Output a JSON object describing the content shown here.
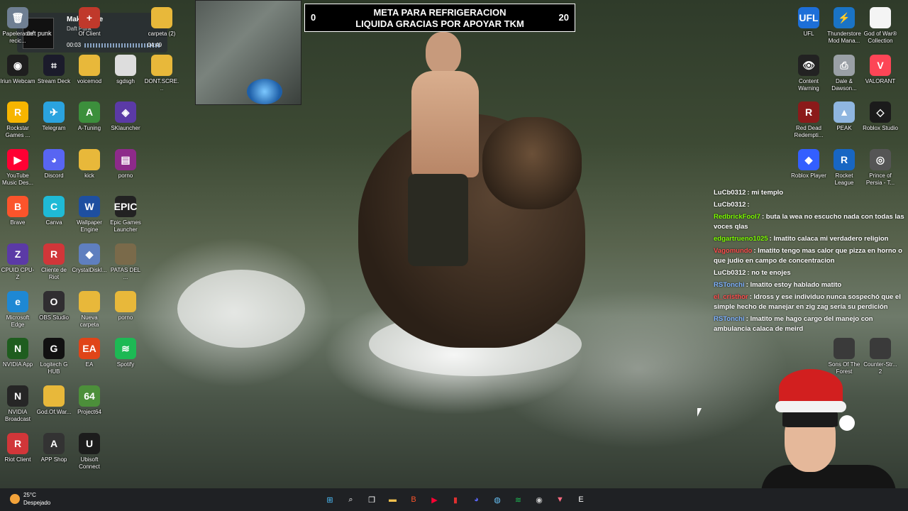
{
  "goal_widget": {
    "left": "0",
    "text_line1": "META PARA REFRIGERACION",
    "text_line2": "LIQUIDA GRACIAS POR APOYAR TKM",
    "right": "20"
  },
  "music_widget": {
    "album": "daft punk",
    "title": "Make Love",
    "artist": "Daft Punk",
    "elapsed": "00:03",
    "total": "04:49"
  },
  "desktop_icons": [
    {
      "label": "Papelera de recic...",
      "icon": "recycle-bin-icon",
      "color": "#6f7f93",
      "glyph": "🗑"
    },
    {
      "label": "Iriun Webcam",
      "icon": "webcam-icon",
      "color": "#1e1e1e",
      "glyph": "◉"
    },
    {
      "label": "Rockstar Games ...",
      "icon": "rockstar-icon",
      "color": "#f7b500",
      "glyph": "R"
    },
    {
      "label": "YouTube Music Des...",
      "icon": "youtube-music-icon",
      "color": "#ff0033",
      "glyph": "▶"
    },
    {
      "label": "Brave",
      "icon": "brave-icon",
      "color": "#fb542b",
      "glyph": "B"
    },
    {
      "label": "CPUID CPU-Z",
      "icon": "cpuz-icon",
      "color": "#5b3aa6",
      "glyph": "Z"
    },
    {
      "label": "Microsoft Edge",
      "icon": "edge-icon",
      "color": "#1e88d4",
      "glyph": "e"
    },
    {
      "label": "NVIDIA App",
      "icon": "nvidia-icon",
      "color": "#1f5d1f",
      "glyph": "N"
    },
    {
      "label": "NVIDIA Broadcast",
      "icon": "nvidia-broadcast-icon",
      "color": "#262626",
      "glyph": "N"
    },
    {
      "label": "Riot Client",
      "icon": "riot-icon",
      "color": "#d13639",
      "glyph": "R"
    },
    {
      "label": "OBS Studio",
      "icon": "obs-icon",
      "color": "#302e31",
      "glyph": "O"
    },
    {
      "label": "Stream Deck",
      "icon": "stream-deck-icon",
      "color": "#1b1b2b",
      "glyph": "⌗"
    },
    {
      "label": "Telegram",
      "icon": "telegram-icon",
      "color": "#2aa3df",
      "glyph": "✈"
    },
    {
      "label": "Discord",
      "icon": "discord-icon",
      "color": "#5865f2",
      "glyph": "◕"
    },
    {
      "label": "Canva",
      "icon": "canva-icon",
      "color": "#1fbad6",
      "glyph": "C"
    },
    {
      "label": "Cliente de Riot",
      "icon": "riot-client-icon",
      "color": "#d13639",
      "glyph": "R"
    },
    {
      "label": "OBS Studio",
      "icon": "obs-icon-2",
      "color": "#302e31",
      "glyph": "O"
    },
    {
      "label": "Logitech G HUB",
      "icon": "logitech-icon",
      "color": "#111111",
      "glyph": "G"
    },
    {
      "label": "God.Of.War...",
      "icon": "folder-icon",
      "color": "#e8b83a",
      "glyph": ""
    },
    {
      "label": "APP Shop",
      "icon": "app-shop-icon",
      "color": "#333333",
      "glyph": "A"
    },
    {
      "label": "Of Client",
      "icon": "client-icon",
      "color": "#c0392b",
      "glyph": "+"
    },
    {
      "label": "voicemod",
      "icon": "folder-icon-2",
      "color": "#e8b83a",
      "glyph": ""
    },
    {
      "label": "A-Tuning",
      "icon": "a-tuning-icon",
      "color": "#3c8f3c",
      "glyph": "A"
    },
    {
      "label": "kick",
      "icon": "kick-folder-icon",
      "color": "#e8b83a",
      "glyph": ""
    },
    {
      "label": "Wallpaper Engine",
      "icon": "wallpaper-engine-icon",
      "color": "#1e4fa0",
      "glyph": "W"
    },
    {
      "label": "CrystalDiskI...",
      "icon": "crystaldisk-icon",
      "color": "#5f7fbf",
      "glyph": "◆"
    },
    {
      "label": "Nueva carpeta",
      "icon": "new-folder-icon",
      "color": "#e8b83a",
      "glyph": ""
    },
    {
      "label": "EA",
      "icon": "ea-icon",
      "color": "#e04418",
      "glyph": "EA"
    },
    {
      "label": "Project64",
      "icon": "project64-icon",
      "color": "#4c8f3a",
      "glyph": "64"
    },
    {
      "label": "Ubisoft Connect",
      "icon": "ubisoft-icon",
      "color": "#1c1c1c",
      "glyph": "U"
    },
    {
      "label": "sgdsgh",
      "icon": "file-icon",
      "color": "#dddddd",
      "glyph": ""
    },
    {
      "label": "SKlauncher",
      "icon": "sklauncher-icon",
      "color": "#5b3aa6",
      "glyph": "◈"
    },
    {
      "label": "porno",
      "icon": "winrar-icon",
      "color": "#8e2a8a",
      "glyph": "▤"
    },
    {
      "label": "Epic Games Launcher",
      "icon": "epic-icon",
      "color": "#222222",
      "glyph": "EPIC"
    },
    {
      "label": "PATAS DEL ...",
      "icon": "patas-icon",
      "color": "#7a6a4a",
      "glyph": ""
    },
    {
      "label": "porno",
      "icon": "folder-icon-3",
      "color": "#e8b83a",
      "glyph": ""
    },
    {
      "label": "Spotify",
      "icon": "spotify-icon",
      "color": "#1db954",
      "glyph": "≋"
    },
    {
      "label": "carpeta (2)",
      "icon": "folder-icon-4",
      "color": "#e8b83a",
      "glyph": ""
    },
    {
      "label": "DONT.SCRE...",
      "icon": "folder-icon-5",
      "color": "#e8b83a",
      "glyph": ""
    },
    {
      "label": "UFL",
      "icon": "ufl-icon",
      "color": "#1d6fd8",
      "glyph": "UFL"
    },
    {
      "label": "Thunderstore Mod Mana...",
      "icon": "thunderstore-icon",
      "color": "#1a73c5",
      "glyph": "⚡"
    },
    {
      "label": "God of War® Collection",
      "icon": "document-icon",
      "color": "#f4f4f4",
      "glyph": ""
    },
    {
      "label": "Content Warning",
      "icon": "content-warning-icon",
      "color": "#222222",
      "glyph": "👁"
    },
    {
      "label": "Dale & Dawson...",
      "icon": "dale-dawson-icon",
      "color": "#9aa0a6",
      "glyph": "⎙"
    },
    {
      "label": "VALORANT",
      "icon": "valorant-icon",
      "color": "#fd4556",
      "glyph": "V"
    },
    {
      "label": "Red Dead Redempti...",
      "icon": "rdr-icon",
      "color": "#8b1a1a",
      "glyph": "R"
    },
    {
      "label": "PEAK",
      "icon": "peak-icon",
      "color": "#8fb6e0",
      "glyph": "▲"
    },
    {
      "label": "Roblox Studio",
      "icon": "roblox-studio-icon",
      "color": "#1b1b1b",
      "glyph": "◇"
    },
    {
      "label": "Roblox Player",
      "icon": "roblox-player-icon",
      "color": "#335fff",
      "glyph": "◆"
    },
    {
      "label": "Rocket League",
      "icon": "rocket-league-icon",
      "color": "#1866c3",
      "glyph": "R"
    },
    {
      "label": "Prince of Persia - T...",
      "icon": "prince-persia-icon",
      "color": "#555555",
      "glyph": "◎"
    },
    {
      "label": "Sons Of The Forest",
      "icon": "sons-forest-icon",
      "color": "#3a3a3a",
      "glyph": ""
    },
    {
      "label": "Counter-Str... 2",
      "icon": "cs2-icon",
      "color": "#3a3a3a",
      "glyph": ""
    }
  ],
  "chat": [
    {
      "user": "LuCb0312",
      "user_color": "#ffffff",
      "text": ": mi templo"
    },
    {
      "user": "LuCb0312",
      "user_color": "#ffffff",
      "text": ":"
    },
    {
      "user": "RedbrickFool7",
      "user_color": "#7cfc00",
      "text": ": buta la wea no escucho nada con todas las voces qlas"
    },
    {
      "user": "edgartrueno1025",
      "user_color": "#7cfc00",
      "text": ": lmatito calaca mi verdadero religion"
    },
    {
      "user": "Vagomundo",
      "user_color": "#ff4d4d",
      "text": ": lmatito tengo mas calor que pizza en horno o que judio en campo de concentracion"
    },
    {
      "user": "LuCb0312",
      "user_color": "#ffffff",
      "text": ": no te enojes"
    },
    {
      "user": "RSTonchi",
      "user_color": "#7fb2ff",
      "text": ": lmatito  estoy hablado  matito"
    },
    {
      "user": "el_cristhor",
      "user_color": "#ff4d4d",
      "text": ": ldross y ese individuo nunca sospechó que el simple hecho de manejar en zig zag sería su perdición"
    },
    {
      "user": "RSTonchi",
      "user_color": "#7fb2ff",
      "text": ": lmatito  me hago cargo del manejo con ambulancia calaca de meird"
    }
  ],
  "taskbar": {
    "weather_temp": "25°C",
    "weather_desc": "Despejado",
    "apps": [
      {
        "name": "start-button",
        "glyph": "⊞",
        "color": "#4cc2ff"
      },
      {
        "name": "search-button",
        "glyph": "⌕",
        "color": "#ffffff"
      },
      {
        "name": "task-view-button",
        "glyph": "❐",
        "color": "#ffffff"
      },
      {
        "name": "file-explorer-button",
        "glyph": "▬",
        "color": "#f2c14e"
      },
      {
        "name": "brave-taskbar-button",
        "glyph": "B",
        "color": "#fb542b"
      },
      {
        "name": "youtube-music-taskbar-button",
        "glyph": "▶",
        "color": "#ff0033"
      },
      {
        "name": "app-taskbar-button",
        "glyph": "▮",
        "color": "#e03030"
      },
      {
        "name": "discord-taskbar-button",
        "glyph": "◕",
        "color": "#5865f2"
      },
      {
        "name": "steam-taskbar-button",
        "glyph": "◍",
        "color": "#66c0f4"
      },
      {
        "name": "spotify-taskbar-button",
        "glyph": "≋",
        "color": "#1db954"
      },
      {
        "name": "obs-taskbar-button",
        "glyph": "◉",
        "color": "#cccccc"
      },
      {
        "name": "game-taskbar-button",
        "glyph": "▼",
        "color": "#ff6b81"
      },
      {
        "name": "epic-taskbar-button",
        "glyph": "E",
        "color": "#ffffff"
      }
    ]
  }
}
